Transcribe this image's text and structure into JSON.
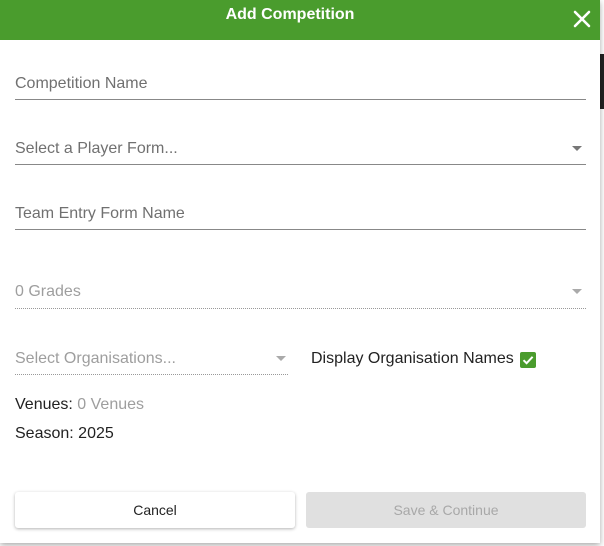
{
  "dialog": {
    "title": "Add Competition",
    "close_icon": "close-icon"
  },
  "form": {
    "competition_name_placeholder": "Competition Name",
    "player_form_placeholder": "Select a Player Form...",
    "team_entry_form_placeholder": "Team Entry Form Name",
    "grades_value": "0 Grades",
    "organisations_placeholder": "Select Organisations...",
    "display_org_names_label": "Display Organisation Names",
    "display_org_names_checked": true,
    "venues_label": "Venues:",
    "venues_value": "0 Venues",
    "season_label": "Season:",
    "season_value": "2025"
  },
  "actions": {
    "cancel_label": "Cancel",
    "save_label": "Save & Continue"
  },
  "colors": {
    "header": "#4a9c2d",
    "checkbox": "#4a9c2d"
  }
}
